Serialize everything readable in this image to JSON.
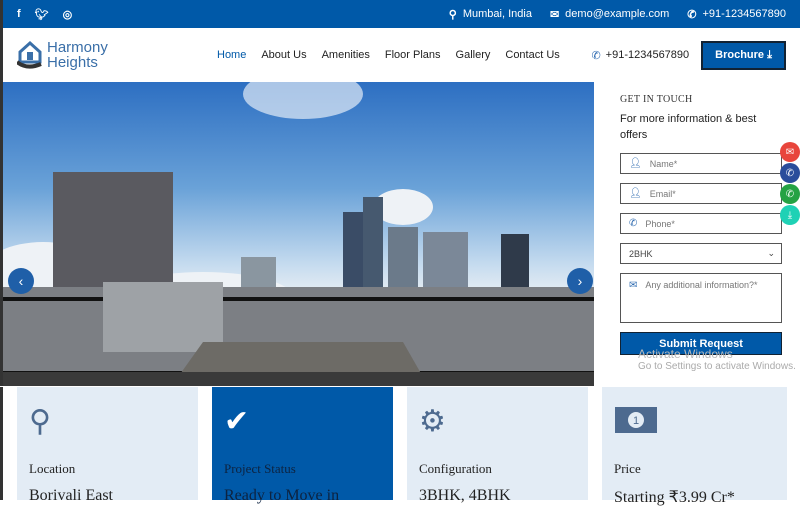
{
  "topbar": {
    "social": [
      "f",
      "t",
      "ig"
    ],
    "location": "Mumbai, India",
    "email": "demo@example.com",
    "phone": "+91-1234567890"
  },
  "nav": {
    "logo_line1": "Harmony",
    "logo_line2": "Heights",
    "items": [
      "Home",
      "About Us",
      "Amenities",
      "Floor Plans",
      "Gallery",
      "Contact Us"
    ],
    "phone": "+91-1234567890",
    "brochure": "Brochure"
  },
  "form": {
    "heading": "GET IN TOUCH",
    "subheading": "For more information & best offers",
    "name_placeholder": "Name*",
    "email_placeholder": "Email*",
    "phone_placeholder": "Phone*",
    "config_selected": "2BHK",
    "info_placeholder": "Any additional information?*",
    "submit": "Submit Request"
  },
  "floating": [
    {
      "icon": "mail-icon",
      "color": "#e8453c"
    },
    {
      "icon": "phone-icon",
      "color": "#2a4d9b"
    },
    {
      "icon": "whatsapp-icon",
      "color": "#25a244"
    },
    {
      "icon": "download-icon",
      "color": "#1fd1b5"
    }
  ],
  "watermark": {
    "title": "Activate Windows",
    "sub": "Go to Settings to activate Windows."
  },
  "cards": [
    {
      "label": "Location",
      "value": "Borivali East",
      "icon": "map-pin-icon"
    },
    {
      "label": "Project Status",
      "value": "Ready to Move in",
      "icon": "check-icon"
    },
    {
      "label": "Configuration",
      "value": "3BHK, 4BHK",
      "icon": "gear-icon"
    },
    {
      "label": "Price",
      "value": "Starting ₹3.99 Cr*",
      "icon": "banknote-icon"
    }
  ],
  "colors": {
    "primary": "#0059a8",
    "card_bg": "#e3ecf5"
  }
}
